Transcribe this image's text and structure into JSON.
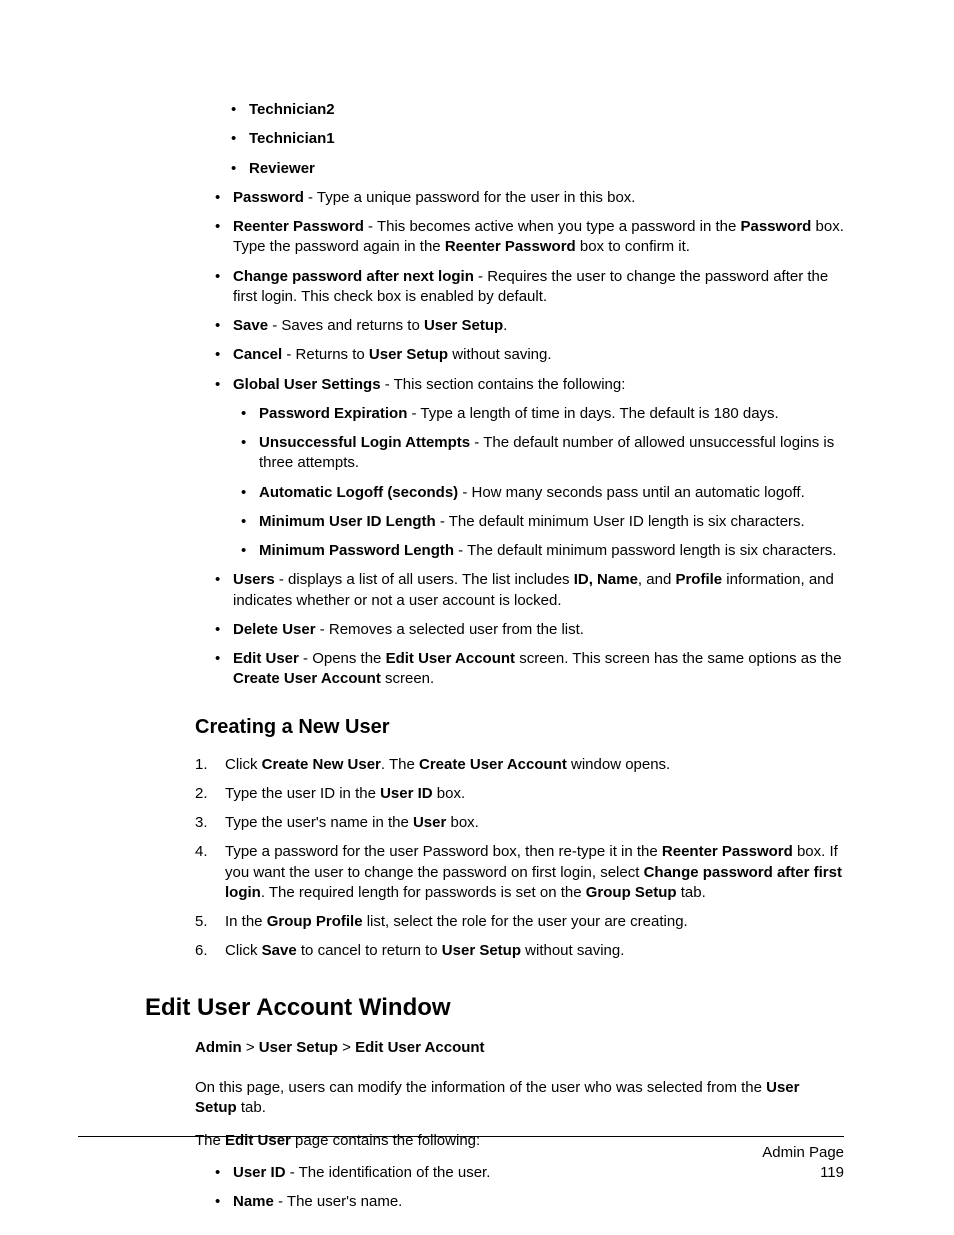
{
  "roles": [
    "Technician2",
    "Technician1",
    "Reviewer"
  ],
  "items": {
    "password": {
      "label": "Password",
      "text": " - Type a unique password for the user in this box."
    },
    "reenter": {
      "label": "Reenter Password",
      "t1": " - This becomes active when you type a password in the ",
      "b1": "Password",
      "t2": " box. Type the password again in the ",
      "b2": "Reenter Password",
      "t3": " box to confirm it."
    },
    "change_pw": {
      "label": "Change password after next login",
      "text": " - Requires the user to change the password after the first login. This check box is enabled by default."
    },
    "save": {
      "label": "Save",
      "t1": " - Saves and returns to ",
      "b1": "User Setup",
      "t2": "."
    },
    "cancel": {
      "label": "Cancel",
      "t1": " - Returns to ",
      "b1": "User Setup",
      "t2": " without saving."
    },
    "global": {
      "label": "Global User Settings",
      "text": " - This section contains the following:"
    },
    "global_sub": {
      "pw_exp": {
        "label": "Password Expiration",
        "text": " - Type a length of time in days. The default is 180 days."
      },
      "unsucc": {
        "label": "Unsuccessful Login Attempts",
        "text": " - The default number of allowed unsuccessful logins is three attempts."
      },
      "autolog": {
        "label": "Automatic Logoff (seconds)",
        "text": " - How many seconds pass until an automatic logoff."
      },
      "minuid": {
        "label": "Minimum User ID Length",
        "text": " - The default minimum User ID length is six characters."
      },
      "minpw": {
        "label": "Minimum Password Length",
        "text": " - The default minimum password length is six characters."
      }
    },
    "users": {
      "label": "Users",
      "t1": " - displays a list of all users. The list includes ",
      "b1": "ID, Name",
      "t2": ", and ",
      "b2": "Profile",
      "t3": " information, and indicates whether or not a user account is locked."
    },
    "delete": {
      "label": "Delete User",
      "text": " - Removes a selected user from the list."
    },
    "edit": {
      "label": "Edit User",
      "t1": " - Opens the ",
      "b1": "Edit User Account",
      "t2": " screen. This screen has the same options as the ",
      "b2": "Create User Account",
      "t3": " screen."
    }
  },
  "creating_heading": "Creating a New User",
  "steps": {
    "s1": {
      "t1": "Click ",
      "b1": "Create New User",
      "t2": ". The ",
      "b2": "Create User Account",
      "t3": " window opens."
    },
    "s2": {
      "t1": "Type the user ID in the ",
      "b1": "User ID",
      "t2": " box."
    },
    "s3": {
      "t1": "Type the user's name in the ",
      "b1": "User",
      "t2": " box."
    },
    "s4": {
      "t1": "Type a password for the user Password box, then re-type it in the ",
      "b1": "Reenter Password",
      "t2": " box. If you want the user to change the password on first login, select ",
      "b2": "Change password after first login",
      "t3": ". The required length for passwords is set on the ",
      "b3": "Group Setup",
      "t4": " tab."
    },
    "s5": {
      "t1": "In the ",
      "b1": "Group Profile",
      "t2": " list, select the role for the user your are creating."
    },
    "s6": {
      "t1": "Click ",
      "b1": "Save",
      "t2": " to cancel to return to ",
      "b2": "User Setup",
      "t3": " without saving."
    }
  },
  "edit_heading": "Edit User Account Window",
  "breadcrumb": {
    "a": "Admin",
    "sep1": " > ",
    "b": "User Setup",
    "sep2": " > ",
    "c": "Edit User Account"
  },
  "edit_intro": {
    "t1": "On this page, users can modify the information of the user who was selected from the ",
    "b1": "User Setup",
    "t2": " tab."
  },
  "edit_contains": {
    "t1": "The ",
    "b1": "Edit User",
    "t2": " page contains the following:"
  },
  "edit_items": {
    "uid": {
      "label": "User ID",
      "text": " - The identification of the user."
    },
    "name": {
      "label": "Name",
      "text": " - The user's name."
    }
  },
  "footer": {
    "title": "Admin Page",
    "page": "119"
  }
}
